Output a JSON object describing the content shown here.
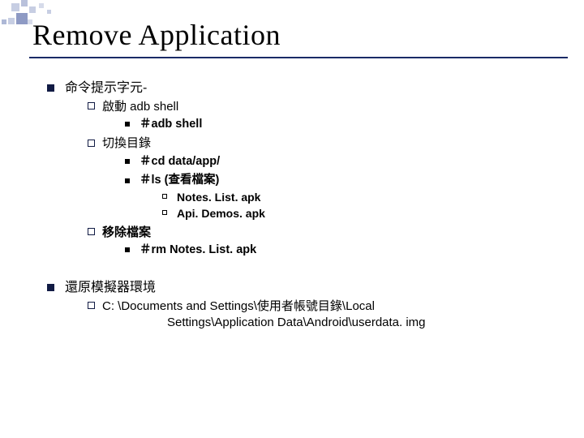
{
  "title": "Remove Application",
  "sections": [
    {
      "label": "命令提示字元-",
      "items": [
        {
          "label": "啟動 adb shell",
          "items": [
            {
              "label": "＃adb shell"
            }
          ]
        },
        {
          "label": "切換目錄",
          "items": [
            {
              "label": "＃cd data/app/"
            },
            {
              "label": "＃ls (查看檔案)",
              "items": [
                {
                  "label": "Notes. List. apk"
                },
                {
                  "label": "Api. Demos. apk"
                }
              ]
            }
          ]
        },
        {
          "label": "移除檔案",
          "items": [
            {
              "label": "＃rm Notes. List. apk"
            }
          ]
        }
      ]
    },
    {
      "label": "還原模擬器環境",
      "items": [
        {
          "line1": "C: \\Documents and Settings\\使用者帳號目錄\\Local",
          "line2": "Settings\\Application Data\\Android\\userdata. img"
        }
      ]
    }
  ]
}
